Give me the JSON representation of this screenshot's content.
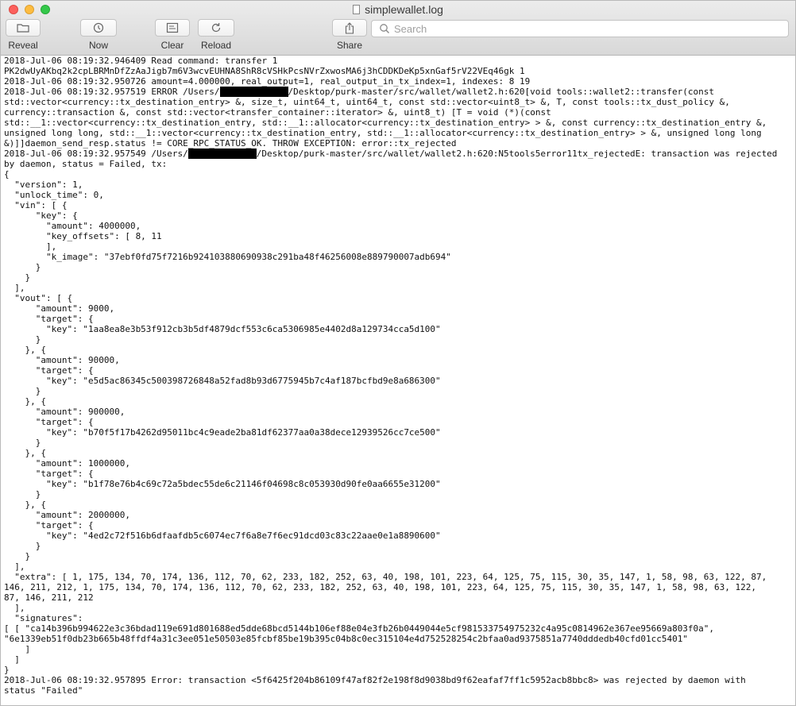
{
  "window": {
    "title": "simplewallet.log"
  },
  "toolbar": {
    "reveal": "Reveal",
    "now": "Now",
    "clear": "Clear",
    "reload": "Reload",
    "share": "Share"
  },
  "search": {
    "placeholder": "Search"
  },
  "log_lines": [
    "2018-Jul-06 08:19:32.946409 Read command: transfer 1",
    "PK2dwUyAKbq2k2cpLBRMnDfZzAaJigb7m6V3wcvEUHNA8ShR8cVSHkPcsNVrZxwosMA6j3hCDDKDeKp5xnGaf5rV22VEq46gk 1",
    "2018-Jul-06 08:19:32.950726 amount=4.000000, real_output=1, real_output_in_tx_index=1, indexes: 8 19",
    [
      "2018-Jul-06 08:19:32.957519 ERROR /Users/",
      "/Desktop/purk-master/src/wallet/wallet2.h:620[void tools::wallet2::transfer(const"
    ],
    "std::vector<currency::tx_destination_entry> &, size_t, uint64_t, uint64_t, const std::vector<uint8_t> &, T, const tools::tx_dust_policy &,",
    "currency::transaction &, const std::vector<transfer_container::iterator> &, uint8_t) [T = void (*)(const",
    "std::__1::vector<currency::tx_destination_entry, std::__1::allocator<currency::tx_destination_entry> > &, const currency::tx_destination_entry &,",
    "unsigned long long, std::__1::vector<currency::tx_destination_entry, std::__1::allocator<currency::tx_destination_entry> > &, unsigned long long",
    "&)]]daemon_send_resp.status != CORE_RPC_STATUS_OK. THROW EXCEPTION: error::tx_rejected",
    [
      "2018-Jul-06 08:19:32.957549 /Users/",
      "/Desktop/purk-master/src/wallet/wallet2.h:620:N5tools5error11tx_rejectedE: transaction was rejected"
    ],
    "by daemon, status = Failed, tx:",
    "{",
    "  \"version\": 1,",
    "  \"unlock_time\": 0,",
    "  \"vin\": [ {",
    "      \"key\": {",
    "        \"amount\": 4000000,",
    "        \"key_offsets\": [ 8, 11",
    "        ],",
    "        \"k_image\": \"37ebf0fd75f7216b924103880690938c291ba48f46256008e889790007adb694\"",
    "      }",
    "    }",
    "  ],",
    "  \"vout\": [ {",
    "      \"amount\": 9000,",
    "      \"target\": {",
    "        \"key\": \"1aa8ea8e3b53f912cb3b5df4879dcf553c6ca5306985e4402d8a129734cca5d100\"",
    "      }",
    "    }, {",
    "      \"amount\": 90000,",
    "      \"target\": {",
    "        \"key\": \"e5d5ac86345c500398726848a52fad8b93d6775945b7c4af187bcfbd9e8a686300\"",
    "      }",
    "    }, {",
    "      \"amount\": 900000,",
    "      \"target\": {",
    "        \"key\": \"b70f5f17b4262d95011bc4c9eade2ba81df62377aa0a38dece12939526cc7ce500\"",
    "      }",
    "    }, {",
    "      \"amount\": 1000000,",
    "      \"target\": {",
    "        \"key\": \"b1f78e76b4c69c72a5bdec55de6c21146f04698c8c053930d90fe0aa6655e31200\"",
    "      }",
    "    }, {",
    "      \"amount\": 2000000,",
    "      \"target\": {",
    "        \"key\": \"4ed2c72f516b6dfaafdb5c6074ec7f6a8e7f6ec91dcd03c83c22aae0e1a8890600\"",
    "      }",
    "    }",
    "  ],",
    "  \"extra\": [ 1, 175, 134, 70, 174, 136, 112, 70, 62, 233, 182, 252, 63, 40, 198, 101, 223, 64, 125, 75, 115, 30, 35, 147, 1, 58, 98, 63, 122, 87,",
    "146, 211, 212, 1, 175, 134, 70, 174, 136, 112, 70, 62, 233, 182, 252, 63, 40, 198, 101, 223, 64, 125, 75, 115, 30, 35, 147, 1, 58, 98, 63, 122,",
    "87, 146, 211, 212",
    "  ],",
    "  \"signatures\":",
    "[ [ \"ca14b396b994622e3c36bdad119e691d801688ed5dde68bcd5144b106ef88e04e3fb26b0449044e5cf981533754975232c4a95c0814962e367ee95669a803f0a\",",
    "\"6e1339eb51f0db23b665b48ffdf4a31c3ee051e50503e85fcbf85be19b395c04b8c0ec315104e4d752528254c2bfaa0ad9375851a7740dddedb40cfd01cc5401\"",
    "    ]",
    "  ]",
    "}",
    "2018-Jul-06 08:19:32.957895 Error: transaction <5f6425f204b86109f47af82f2e198f8d9038bd9f62eafaf7ff1c5952acb8bbc8> was rejected by daemon with",
    "status \"Failed\""
  ]
}
